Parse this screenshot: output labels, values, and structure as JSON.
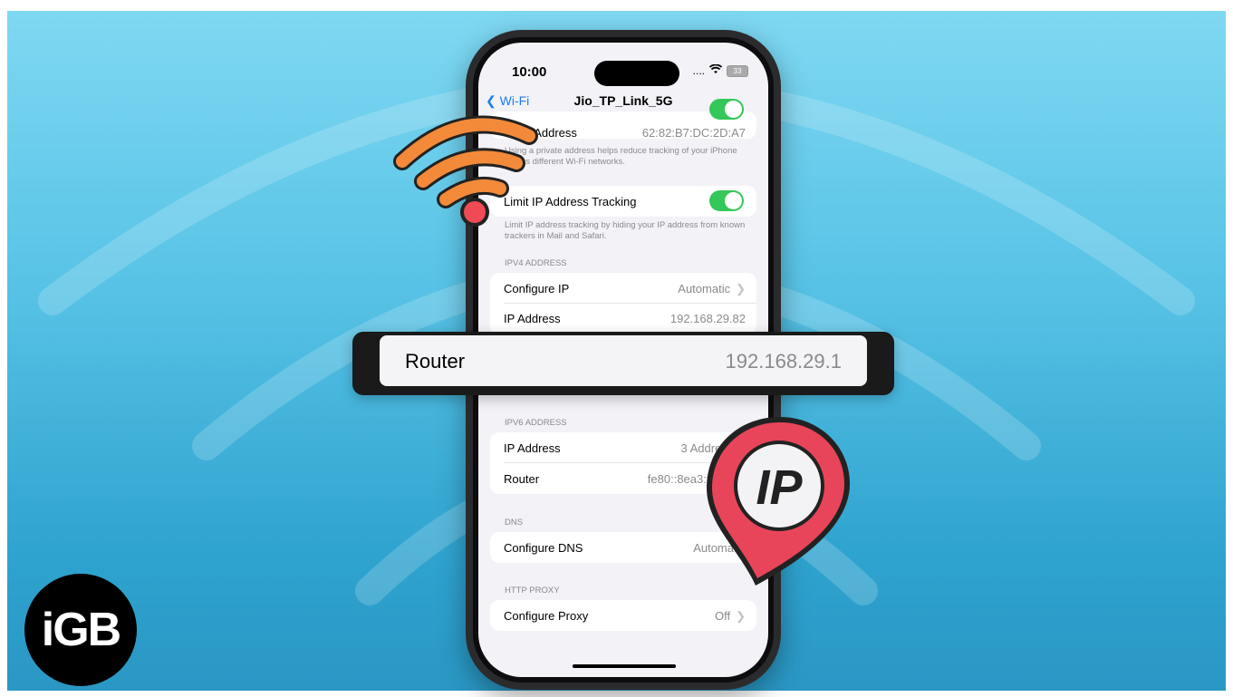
{
  "status_bar": {
    "time": "10:00",
    "signal": "....",
    "battery": "33"
  },
  "nav": {
    "back_label": "Wi-Fi",
    "title": "Jio_TP_Link_5G"
  },
  "wifi_address": {
    "label": "Wi-Fi Address",
    "value": "62:82:B7:DC:2D:A7",
    "footnote": "Using a private address helps reduce tracking of your iPhone across different Wi-Fi networks."
  },
  "limit_ip": {
    "label": "Limit IP Address Tracking",
    "enabled": true,
    "footnote": "Limit IP address tracking by hiding your IP address from known trackers in Mail and Safari."
  },
  "ipv4": {
    "section": "IPV4 ADDRESS",
    "rows": [
      {
        "label": "Configure IP",
        "value": "Automatic"
      },
      {
        "label": "IP Address",
        "value": "192.168.29.82"
      }
    ]
  },
  "callout": {
    "label": "Router",
    "value": "192.168.29.1"
  },
  "ipv6": {
    "section": "IPV6 ADDRESS",
    "rows": [
      {
        "label": "IP Address",
        "value": "3 Addresses"
      },
      {
        "label": "Router",
        "value": "fe80::8ea3:99ff:fe9"
      }
    ]
  },
  "dns": {
    "section": "DNS",
    "label": "Configure DNS",
    "value": "Automatic"
  },
  "proxy": {
    "section": "HTTP PROXY",
    "label": "Configure Proxy",
    "value": "Off"
  },
  "ip_pin": {
    "text": "IP"
  },
  "logo": {
    "text": "iGB"
  },
  "colors": {
    "wifi_orange": "#f28a3a",
    "pin_red": "#e8455a",
    "toggle_green": "#34c759",
    "link_blue": "#1a7cf2"
  }
}
